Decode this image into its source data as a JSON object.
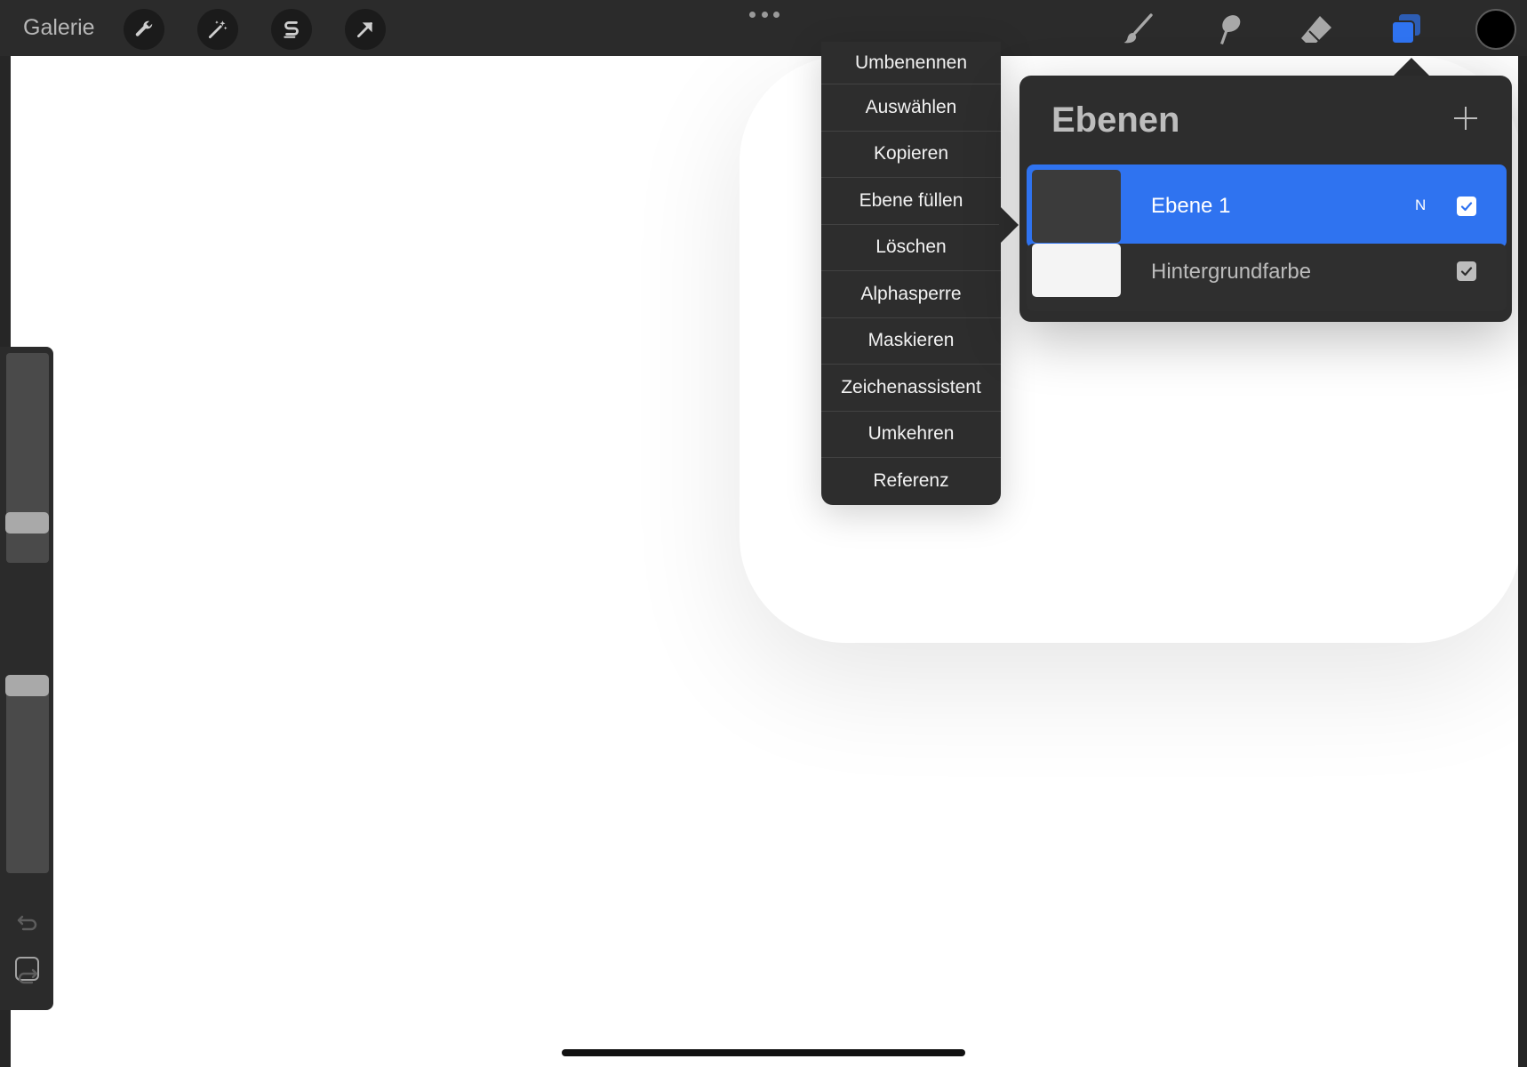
{
  "toolbar": {
    "gallery_label": "Galerie",
    "left_tools": [
      "wrench-icon",
      "magic-wand-icon",
      "selection-s-icon",
      "arrow-transform-icon"
    ],
    "right_tools": [
      "brush-icon",
      "smudge-icon",
      "eraser-icon",
      "layers-icon"
    ],
    "accent_color": "#2f73f0",
    "current_color": "#000000"
  },
  "context_menu": {
    "items": [
      "Umbenennen",
      "Auswählen",
      "Kopieren",
      "Ebene füllen",
      "Löschen",
      "Alphasperre",
      "Maskieren",
      "Zeichenassistent",
      "Umkehren",
      "Referenz"
    ]
  },
  "layers": {
    "title": "Ebenen",
    "rows": [
      {
        "name": "Ebene 1",
        "blend_mode": "N",
        "visible": true,
        "selected": true
      },
      {
        "name": "Hintergrundfarbe",
        "visible": true,
        "selected": false
      }
    ]
  }
}
